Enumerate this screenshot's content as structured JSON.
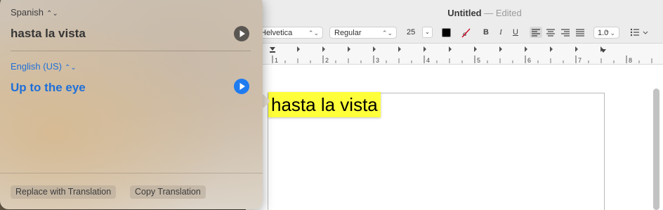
{
  "window": {
    "title": "Untitled",
    "separator": "—",
    "status": "Edited"
  },
  "toolbar": {
    "font_family": "Helvetica",
    "font_style": "Regular",
    "font_size": "25",
    "bold": "B",
    "italic": "I",
    "underline": "U",
    "line_spacing": "1.0",
    "text_color": "#000000",
    "highlight_glyph": "a"
  },
  "ruler": {
    "labels": [
      "1",
      "2",
      "3",
      "4",
      "5",
      "6",
      "7",
      "8"
    ]
  },
  "document": {
    "text": "hasta la vista",
    "highlight_color": "#ffff3a"
  },
  "translation": {
    "source_language": "Spanish",
    "source_text": "hasta la vista",
    "target_language": "English (US)",
    "target_text": "Up to the eye",
    "replace_button": "Replace with Translation",
    "copy_button": "Copy Translation",
    "accent_color": "#1e6fd9"
  }
}
